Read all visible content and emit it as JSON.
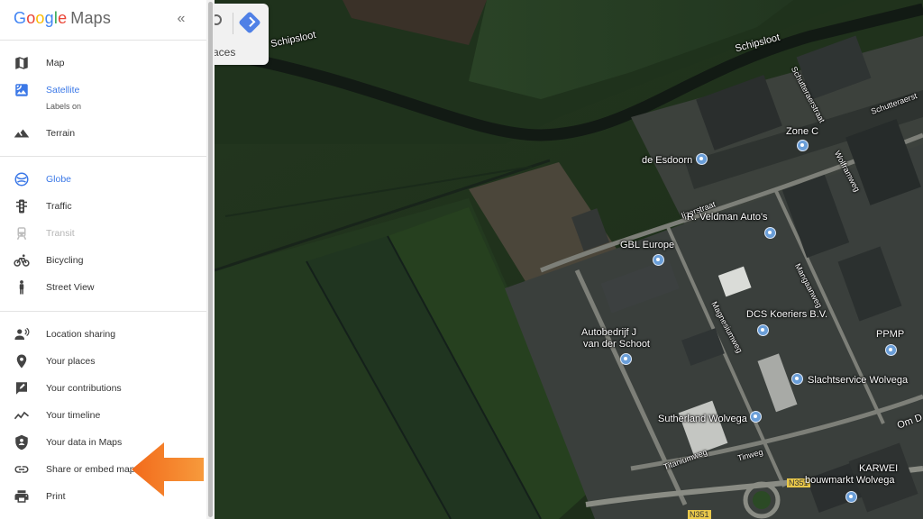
{
  "app": {
    "brand": "Google",
    "product": "Maps"
  },
  "panel": {
    "collapse_icon": "«",
    "map_types": [
      {
        "label": "Map",
        "icon": "map-icon",
        "active": false
      },
      {
        "label": "Satellite",
        "sub": "Labels on",
        "icon": "satellite-icon",
        "active": true
      },
      {
        "label": "Terrain",
        "icon": "terrain-icon",
        "active": false
      }
    ],
    "layers": [
      {
        "label": "Globe",
        "icon": "globe-icon",
        "active": true
      },
      {
        "label": "Traffic",
        "icon": "traffic-icon"
      },
      {
        "label": "Transit",
        "icon": "transit-icon",
        "disabled": true
      },
      {
        "label": "Bicycling",
        "icon": "bicycle-icon"
      },
      {
        "label": "Street View",
        "icon": "pegman-icon"
      }
    ],
    "actions": [
      {
        "label": "Location sharing",
        "icon": "location-sharing-icon"
      },
      {
        "label": "Your places",
        "icon": "place-pin-icon"
      },
      {
        "label": "Your contributions",
        "icon": "contributions-icon"
      },
      {
        "label": "Your timeline",
        "icon": "timeline-icon"
      },
      {
        "label": "Your data in Maps",
        "icon": "shield-person-icon"
      },
      {
        "label": "Share or embed map",
        "icon": "link-icon"
      },
      {
        "label": "Print",
        "icon": "printer-icon"
      }
    ]
  },
  "search": {
    "partial_text": "aces"
  },
  "map": {
    "labels": {
      "schipsloot_1": "Schipsloot",
      "schipsloot_2": "Schipsloot",
      "schutteraerstraat": "Schutteraerstraat",
      "schutteraerstr_short": "Schutteraerst",
      "zone_c": "Zone C",
      "de_esdoorn": "de Esdoorn",
      "veldman": "R. Veldman Auto's",
      "gbl": "GBL Europe",
      "dcs": "DCS Koeriers B.V.",
      "autobedrijf": "Autobedrijf J\nvan der Schoot",
      "autobedrijf_1": "Autobedrijf J",
      "autobedrijf_2": "van der Schoot",
      "ppmp": "PPMP",
      "slachtservice": "Slachtservice Wolvega",
      "sutherland": "Sutherland Wolvega",
      "karwei_1": "KARWEI",
      "karwei_2": "bouwmarkt Wolvega",
      "tinweg": "Tinweg",
      "titaniumweg": "Titaniumweg",
      "magnesiumweg": "Magnesiumweg",
      "mangaanweg": "Mangaanweg",
      "wolframweg": "Wolframweg",
      "om": "Om D",
      "ijzerstraat": "Ijzerstraat",
      "n351": "N351",
      "n351b": "N351"
    }
  },
  "colors": {
    "accent": "#3b78e7",
    "arrow": "#f47c20"
  }
}
